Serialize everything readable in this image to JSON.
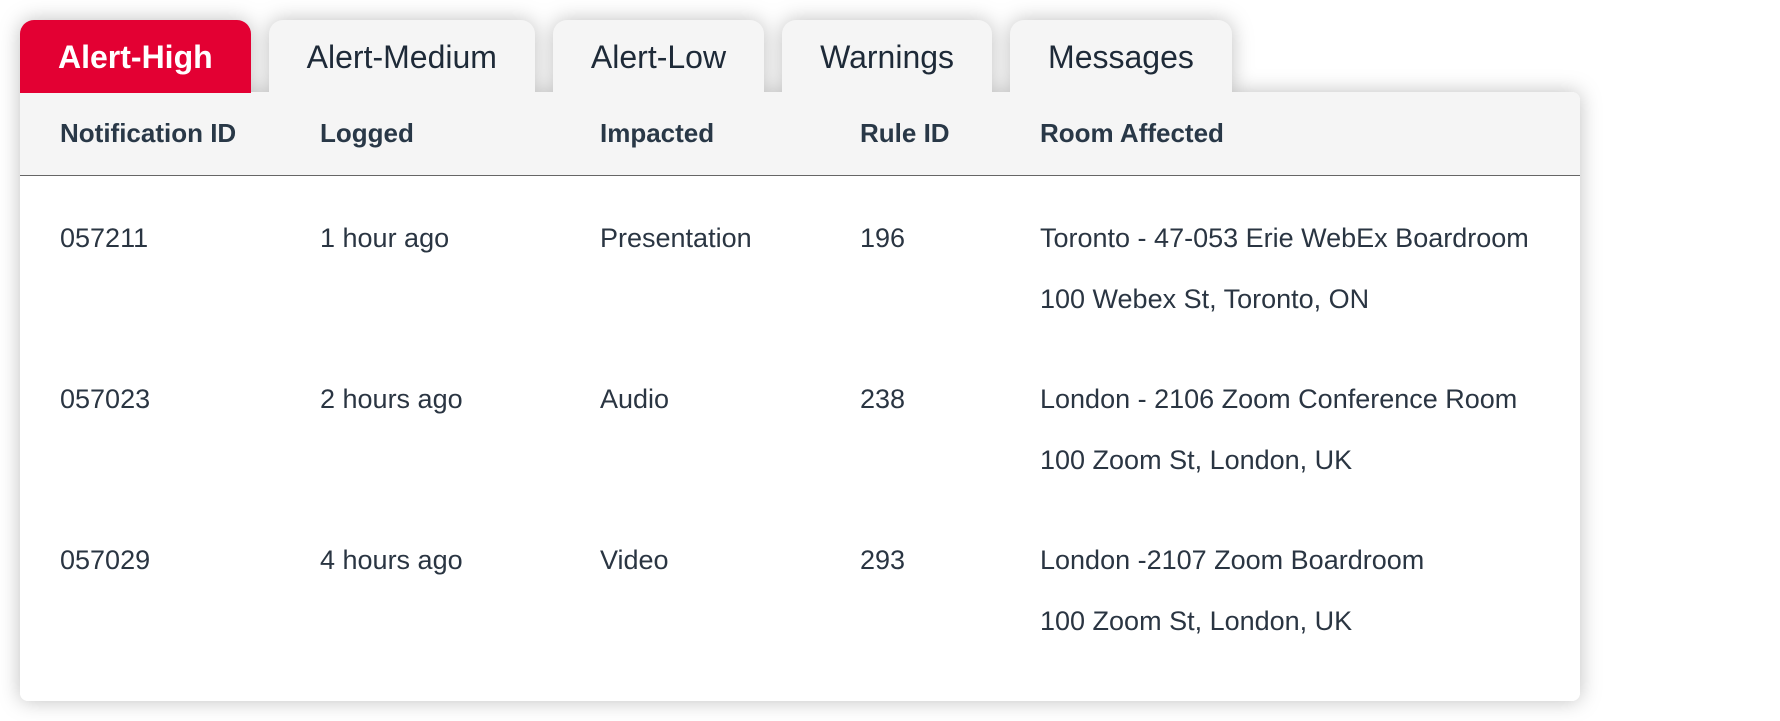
{
  "tabs": [
    {
      "label": "Alert-High",
      "active": true
    },
    {
      "label": "Alert-Medium",
      "active": false
    },
    {
      "label": "Alert-Low",
      "active": false
    },
    {
      "label": "Warnings",
      "active": false
    },
    {
      "label": "Messages",
      "active": false
    }
  ],
  "columns": {
    "notification_id": "Notification ID",
    "logged": "Logged",
    "impacted": "Impacted",
    "rule_id": "Rule ID",
    "room_affected": "Room Affected"
  },
  "rows": [
    {
      "notification_id": "057211",
      "logged": "1 hour ago",
      "impacted": "Presentation",
      "rule_id": "196",
      "room_name": "Toronto - 47-053 Erie WebEx Boardroom",
      "room_addr": "100 Webex St, Toronto, ON"
    },
    {
      "notification_id": "057023",
      "logged": "2 hours ago",
      "impacted": "Audio",
      "rule_id": "238",
      "room_name": "London - 2106 Zoom Conference Room",
      "room_addr": "100 Zoom St, London, UK"
    },
    {
      "notification_id": "057029",
      "logged": "4 hours ago",
      "impacted": "Video",
      "rule_id": "293",
      "room_name": "London -2107 Zoom Boardroom",
      "room_addr": "100 Zoom St, London, UK"
    }
  ],
  "colors": {
    "accent_active": "#e30033",
    "tab_inactive_bg": "#f5f5f5",
    "text_primary": "#293847"
  }
}
